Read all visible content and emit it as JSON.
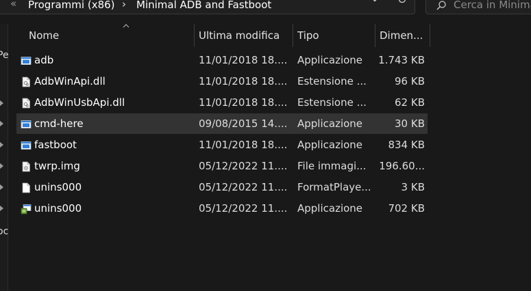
{
  "address": {
    "back_glyph": "«",
    "crumbs": [
      "Programmi (x86)",
      "Minimal ADB and Fastboot"
    ],
    "separator": "›"
  },
  "search": {
    "placeholder": "Cerca in Minimal"
  },
  "nav_fragments": [
    "Pe",
    "oc"
  ],
  "columns": {
    "name": "Nome",
    "date": "Ultima modifica",
    "type": "Tipo",
    "size": "Dimen..."
  },
  "files": [
    {
      "name": "adb",
      "date": "11/01/2018 18....",
      "type": "Applicazione",
      "size": "1.743 KB",
      "icon": "application-icon"
    },
    {
      "name": "AdbWinApi.dll",
      "date": "11/01/2018 18....",
      "type": "Estensione ...",
      "size": "96 KB",
      "icon": "dll-file-icon"
    },
    {
      "name": "AdbWinUsbApi.dll",
      "date": "11/01/2018 18....",
      "type": "Estensione ...",
      "size": "62 KB",
      "icon": "dll-file-icon"
    },
    {
      "name": "cmd-here",
      "date": "09/08/2015 14....",
      "type": "Applicazione",
      "size": "30 KB",
      "icon": "application-icon"
    },
    {
      "name": "fastboot",
      "date": "11/01/2018 18....",
      "type": "Applicazione",
      "size": "834 KB",
      "icon": "application-icon"
    },
    {
      "name": "twrp.img",
      "date": "05/12/2022 11....",
      "type": "File immagi...",
      "size": "196.60...",
      "icon": "disk-image-icon"
    },
    {
      "name": "unins000",
      "date": "05/12/2022 11....",
      "type": "FormatPlaye...",
      "size": "3 KB",
      "icon": "blank-file-icon"
    },
    {
      "name": "unins000",
      "date": "05/12/2022 11....",
      "type": "Applicazione",
      "size": "702 KB",
      "icon": "uninstaller-icon"
    }
  ],
  "selected_row": 3,
  "colors": {
    "background": "#191919",
    "selected_row": "#333333",
    "app_icon_blue": "#2f7fd8"
  }
}
